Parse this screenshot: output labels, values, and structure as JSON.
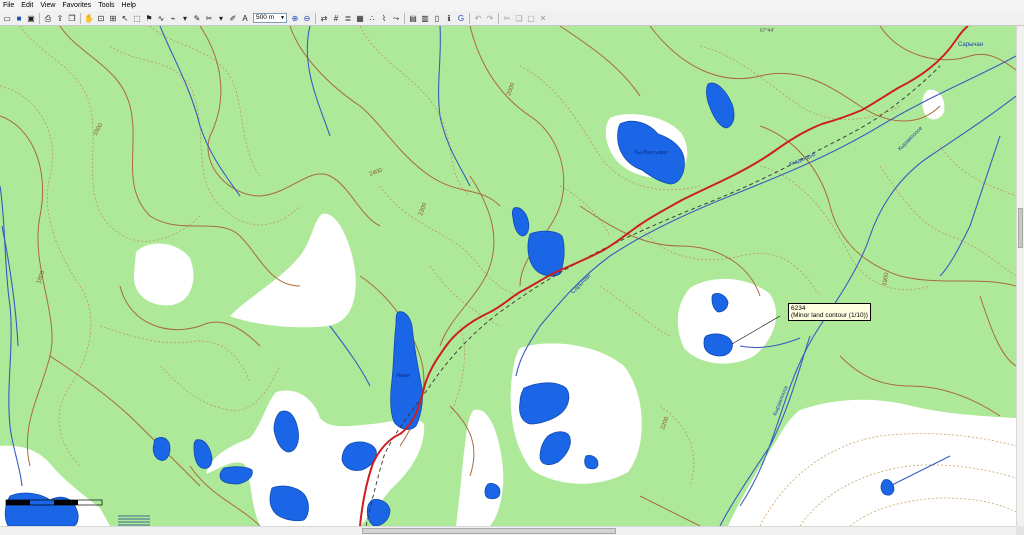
{
  "menu": [
    "File",
    "Edit",
    "View",
    "Favorites",
    "Tools",
    "Help"
  ],
  "toolbar": {
    "scale_value": "500 m"
  },
  "tooltip": {
    "elevation": "6234",
    "description": "(Minor land contour (1/10))"
  },
  "map": {
    "lake_labels": [
      "Ты-Лангъярв",
      "Ямеи"
    ],
    "river_labels": [
      "Сарычан",
      "Сарычан",
      "Ккадандъб",
      "Кырампоосе",
      "Кырампоосе"
    ],
    "contour_labels": [
      "2000",
      "1900",
      "2400",
      "2300",
      "2200",
      "1800",
      "1900"
    ],
    "grid_label": "67°44'"
  },
  "colors": {
    "land": "#aee99a",
    "snow": "#ffffff",
    "water": "#1a66e6",
    "track": "#cc1f1f",
    "contour": "#a86b3a",
    "stream": "#3a5bc0"
  }
}
